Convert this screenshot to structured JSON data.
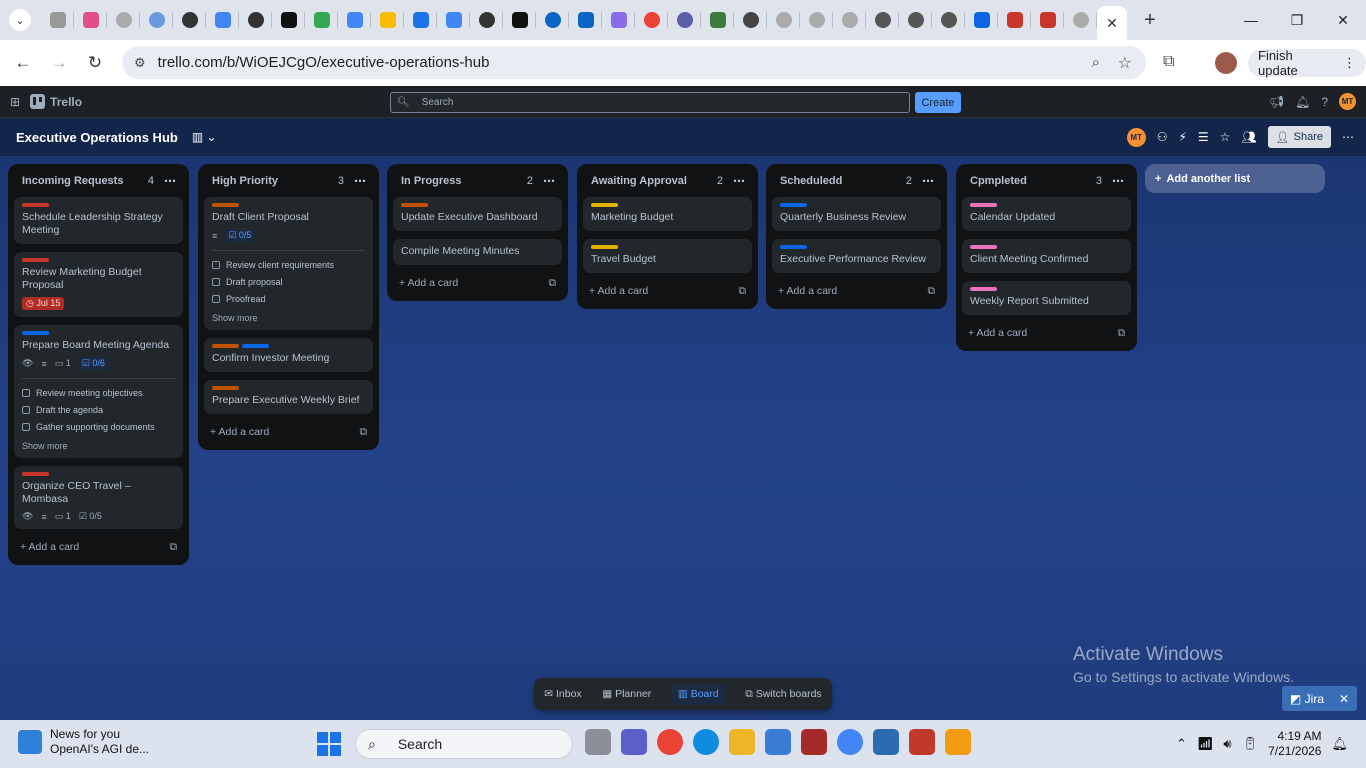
{
  "browser": {
    "url": "trello.com/b/WiOEJCgO/executive-operations-hub",
    "finish_update": "Finish update",
    "close_tab": "✕",
    "new_tab": "+"
  },
  "header": {
    "brand": "Trello",
    "search_placeholder": "Search",
    "create": "Create",
    "avatar": "MT"
  },
  "board": {
    "title": "Executive Operations Hub",
    "share": "Share",
    "avatar": "MT",
    "add_list": "Add another list",
    "lists": [
      {
        "name": "Incoming Requests",
        "count": "4",
        "cards": [
          {
            "title": "Schedule Leadership Strategy Meeting",
            "labels": [
              "#c9372c"
            ]
          },
          {
            "title": "Review Marketing Budget Proposal",
            "labels": [
              "#c9372c"
            ],
            "due": "Jul 15"
          },
          {
            "title": "Prepare Board Meeting Agenda",
            "labels": [
              "#0c66e4"
            ],
            "comments": "1",
            "checklist": "0/6",
            "items": [
              "Review meeting objectives",
              "Draft the agenda",
              "Gather supporting documents"
            ],
            "show_more": "Show more"
          },
          {
            "title": "Organize CEO Travel – Mombasa",
            "labels": [
              "#c9372c"
            ],
            "comments": "1",
            "checklist": "0/5"
          }
        ],
        "add_card": "Add a card"
      },
      {
        "name": "High Priority",
        "count": "3",
        "cards": [
          {
            "title": "Draft Client Proposal",
            "labels": [
              "#c25100"
            ],
            "checklist": "0/5",
            "items": [
              "Review client requirements",
              "Draft proposal",
              "Proofread"
            ],
            "show_more": "Show more"
          },
          {
            "title": "Confirm Investor Meeting",
            "labels": [
              "#c25100",
              "#0c66e4"
            ]
          },
          {
            "title": "Prepare Executive Weekly Brief",
            "labels": [
              "#c25100"
            ]
          }
        ],
        "add_card": "Add a card"
      },
      {
        "name": "In Progress",
        "count": "2",
        "cards": [
          {
            "title": "Update Executive Dashboard",
            "labels": [
              "#c25100"
            ]
          },
          {
            "title": "Compile Meeting Minutes",
            "labels": []
          }
        ],
        "add_card": "Add a card"
      },
      {
        "name": "Awaiting Approval",
        "count": "2",
        "cards": [
          {
            "title": "Marketing Budget",
            "labels": [
              "#e2b203"
            ]
          },
          {
            "title": "Travel Budget",
            "labels": [
              "#e2b203"
            ]
          }
        ],
        "add_card": "Add a card"
      },
      {
        "name": "Scheduledd",
        "count": "2",
        "cards": [
          {
            "title": "Quarterly Business Review",
            "labels": [
              "#0c66e4"
            ]
          },
          {
            "title": "Executive Performance Review",
            "labels": [
              "#0c66e4"
            ]
          }
        ],
        "add_card": "Add a card"
      },
      {
        "name": "Cpmpleted",
        "count": "3",
        "cards": [
          {
            "title": "Calendar Updated",
            "labels": [
              "#e774bb"
            ]
          },
          {
            "title": "Client Meeting Confirmed",
            "labels": [
              "#e774bb"
            ]
          },
          {
            "title": "Weekly Report Submitted",
            "labels": [
              "#e774bb"
            ]
          }
        ],
        "add_card": "Add a card"
      }
    ]
  },
  "bottom_nav": {
    "inbox": "Inbox",
    "planner": "Planner",
    "board": "Board",
    "switch": "Switch boards"
  },
  "watermark": {
    "line1": "Activate Windows",
    "line2": "Go to Settings to activate Windows."
  },
  "jira": "Jira",
  "taskbar": {
    "news_title": "News for you",
    "news_sub": "OpenAI's AGI de...",
    "search": "Search",
    "time": "4:19 AM",
    "date": "7/21/2026"
  }
}
